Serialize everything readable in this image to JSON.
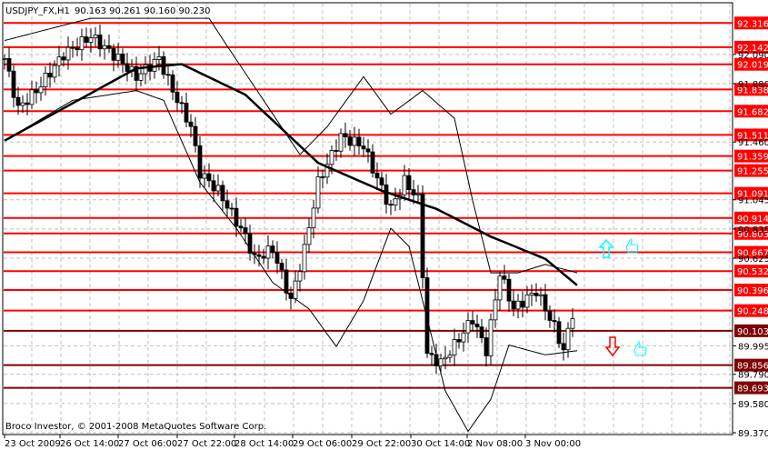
{
  "header": {
    "symbol": "USDJPY_FX,H1",
    "ohlc": "90.163 90.261 90.160 90.230"
  },
  "footer": {
    "copyright": "Broco Investor, © 2001-2008 MetaQuotes Software Corp."
  },
  "colors": {
    "level_red": "#FF0000",
    "level_dark": "#800000",
    "grid": "#C0C0C0",
    "candle": "#000000",
    "up_arrow": "#00FFFF",
    "down_arrow": "#FF0000"
  },
  "icons": {
    "up": "up-arrow-icon",
    "down": "down-arrow-icon",
    "thumb": "thumbs-up-icon"
  },
  "chart_data": {
    "type": "candlestick",
    "title": "USDJPY_FX,H1",
    "ylim": [
      89.37,
      92.316
    ],
    "y_ticks": [
      "92.090",
      "91.880",
      "91.460",
      "91.045",
      "90.835",
      "90.625",
      "89.995",
      "89.790",
      "89.580",
      "89.370"
    ],
    "x_ticks": [
      "23 Oct 2009",
      "26 Oct 14:00",
      "27 Oct 06:00",
      "27 Oct 22:00",
      "28 Oct 14:00",
      "29 Oct 06:00",
      "29 Oct 22:00",
      "30 Oct 14:00",
      "2 Nov 08:00",
      "3 Nov 00:00"
    ],
    "levels": [
      {
        "value": "92.316",
        "kind": "red"
      },
      {
        "value": "92.142",
        "kind": "red"
      },
      {
        "value": "92.019",
        "kind": "red"
      },
      {
        "value": "91.838",
        "kind": "red"
      },
      {
        "value": "91.682",
        "kind": "red"
      },
      {
        "value": "91.511",
        "kind": "red"
      },
      {
        "value": "91.359",
        "kind": "red"
      },
      {
        "value": "91.255",
        "kind": "red"
      },
      {
        "value": "91.091",
        "kind": "red"
      },
      {
        "value": "90.914",
        "kind": "red"
      },
      {
        "value": "90.803",
        "kind": "red"
      },
      {
        "value": "90.667",
        "kind": "red"
      },
      {
        "value": "90.532",
        "kind": "red"
      },
      {
        "value": "90.396",
        "kind": "red"
      },
      {
        "value": "90.248",
        "kind": "red"
      },
      {
        "value": "90.103",
        "kind": "dark"
      },
      {
        "value": "89.856",
        "kind": "dark"
      },
      {
        "value": "89.693",
        "kind": "dark"
      }
    ],
    "price_path": [
      [
        0,
        92.06
      ],
      [
        3,
        91.7
      ],
      [
        7,
        91.83
      ],
      [
        13,
        92.09
      ],
      [
        19,
        92.22
      ],
      [
        25,
        92.06
      ],
      [
        29,
        91.93
      ],
      [
        34,
        92.06
      ],
      [
        37,
        91.83
      ],
      [
        41,
        91.57
      ],
      [
        43,
        91.24
      ],
      [
        47,
        91.11
      ],
      [
        53,
        90.78
      ],
      [
        55,
        90.62
      ],
      [
        59,
        90.69
      ],
      [
        63,
        90.32
      ],
      [
        66,
        90.69
      ],
      [
        69,
        91.17
      ],
      [
        74,
        91.5
      ],
      [
        79,
        91.43
      ],
      [
        81,
        91.27
      ],
      [
        85,
        90.98
      ],
      [
        88,
        91.18
      ],
      [
        91,
        91.05
      ],
      [
        92,
        90.52
      ],
      [
        93,
        89.93
      ],
      [
        96,
        89.87
      ],
      [
        99,
        90.0
      ],
      [
        103,
        90.19
      ],
      [
        106,
        89.96
      ],
      [
        109,
        90.52
      ],
      [
        112,
        90.26
      ],
      [
        117,
        90.39
      ],
      [
        121,
        90.13
      ],
      [
        123,
        89.96
      ],
      [
        125,
        90.23
      ]
    ],
    "moving_average": [
      [
        0,
        91.47
      ],
      [
        29,
        91.99
      ],
      [
        39,
        92.02
      ],
      [
        53,
        91.8
      ],
      [
        69,
        91.31
      ],
      [
        83,
        91.11
      ],
      [
        95,
        90.98
      ],
      [
        107,
        90.78
      ],
      [
        119,
        90.62
      ],
      [
        126,
        90.43
      ]
    ],
    "bollinger_upper": [
      [
        0,
        92.19
      ],
      [
        19,
        92.35
      ],
      [
        45,
        92.35
      ],
      [
        49,
        92.15
      ],
      [
        57,
        91.76
      ],
      [
        65,
        91.37
      ],
      [
        71,
        91.57
      ],
      [
        79,
        91.93
      ],
      [
        85,
        91.66
      ],
      [
        92,
        91.83
      ],
      [
        99,
        91.63
      ],
      [
        103,
        91.04
      ],
      [
        107,
        90.52
      ],
      [
        113,
        90.52
      ],
      [
        119,
        90.58
      ],
      [
        126,
        90.52
      ]
    ],
    "bollinger_lower": [
      [
        0,
        91.47
      ],
      [
        15,
        91.76
      ],
      [
        29,
        91.83
      ],
      [
        35,
        91.76
      ],
      [
        43,
        91.17
      ],
      [
        51,
        90.84
      ],
      [
        59,
        90.45
      ],
      [
        67,
        90.26
      ],
      [
        73,
        89.99
      ],
      [
        79,
        90.32
      ],
      [
        85,
        90.84
      ],
      [
        89,
        90.71
      ],
      [
        93,
        90.19
      ],
      [
        97,
        89.67
      ],
      [
        102,
        89.38
      ],
      [
        107,
        89.61
      ],
      [
        111,
        90.0
      ],
      [
        119,
        89.93
      ],
      [
        126,
        89.96
      ]
    ]
  }
}
